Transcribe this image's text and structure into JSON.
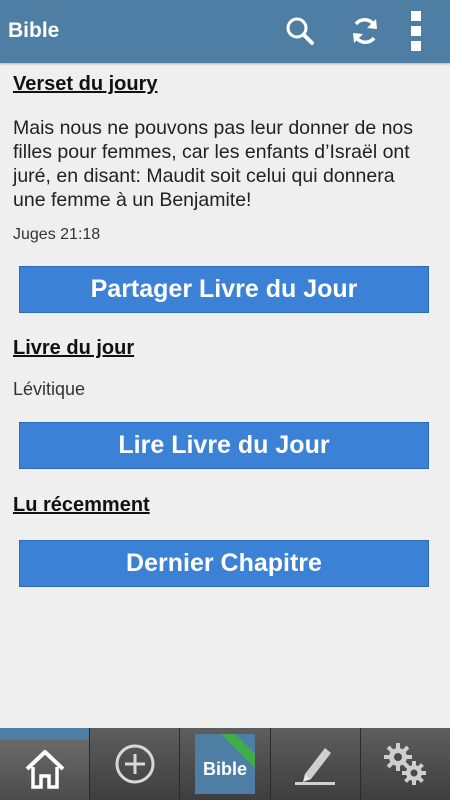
{
  "app_bar": {
    "title": "Bible",
    "actions": [
      {
        "name": "search",
        "icon": "search-icon"
      },
      {
        "name": "refresh",
        "icon": "refresh-icon"
      },
      {
        "name": "overflow",
        "icon": "more-vertical-icon"
      }
    ],
    "color": "#4f7ea5"
  },
  "verse_of_day": {
    "title": "Verset du joury",
    "text": "Mais nous ne pouvons pas leur donner de nos filles pour femmes, car les enfants d’Israël ont juré, en disant: Maudit soit celui qui donnera une femme à un Benjamite!",
    "reference": "Juges 21:18",
    "share_button": "Partager Livre du Jour"
  },
  "book_of_day": {
    "title": "Livre du jour",
    "book": "Lévitique",
    "read_button": "Lire Livre du Jour"
  },
  "recent": {
    "title": "Lu récemment",
    "last_chapter_button": "Dernier Chapitre"
  },
  "bottom_nav": {
    "items": [
      {
        "name": "home",
        "icon": "home-icon",
        "active": true
      },
      {
        "name": "add",
        "icon": "add-circle-icon"
      },
      {
        "name": "bible",
        "icon": "bible-icon",
        "label": "Bible"
      },
      {
        "name": "notes",
        "icon": "pencil-icon"
      },
      {
        "name": "settings",
        "icon": "gears-icon"
      }
    ]
  },
  "colors": {
    "primary_button": "#3b82d6",
    "background": "#efefef",
    "bottom_bar": "#3d3d3d",
    "ribbon": "#3fae4a"
  }
}
